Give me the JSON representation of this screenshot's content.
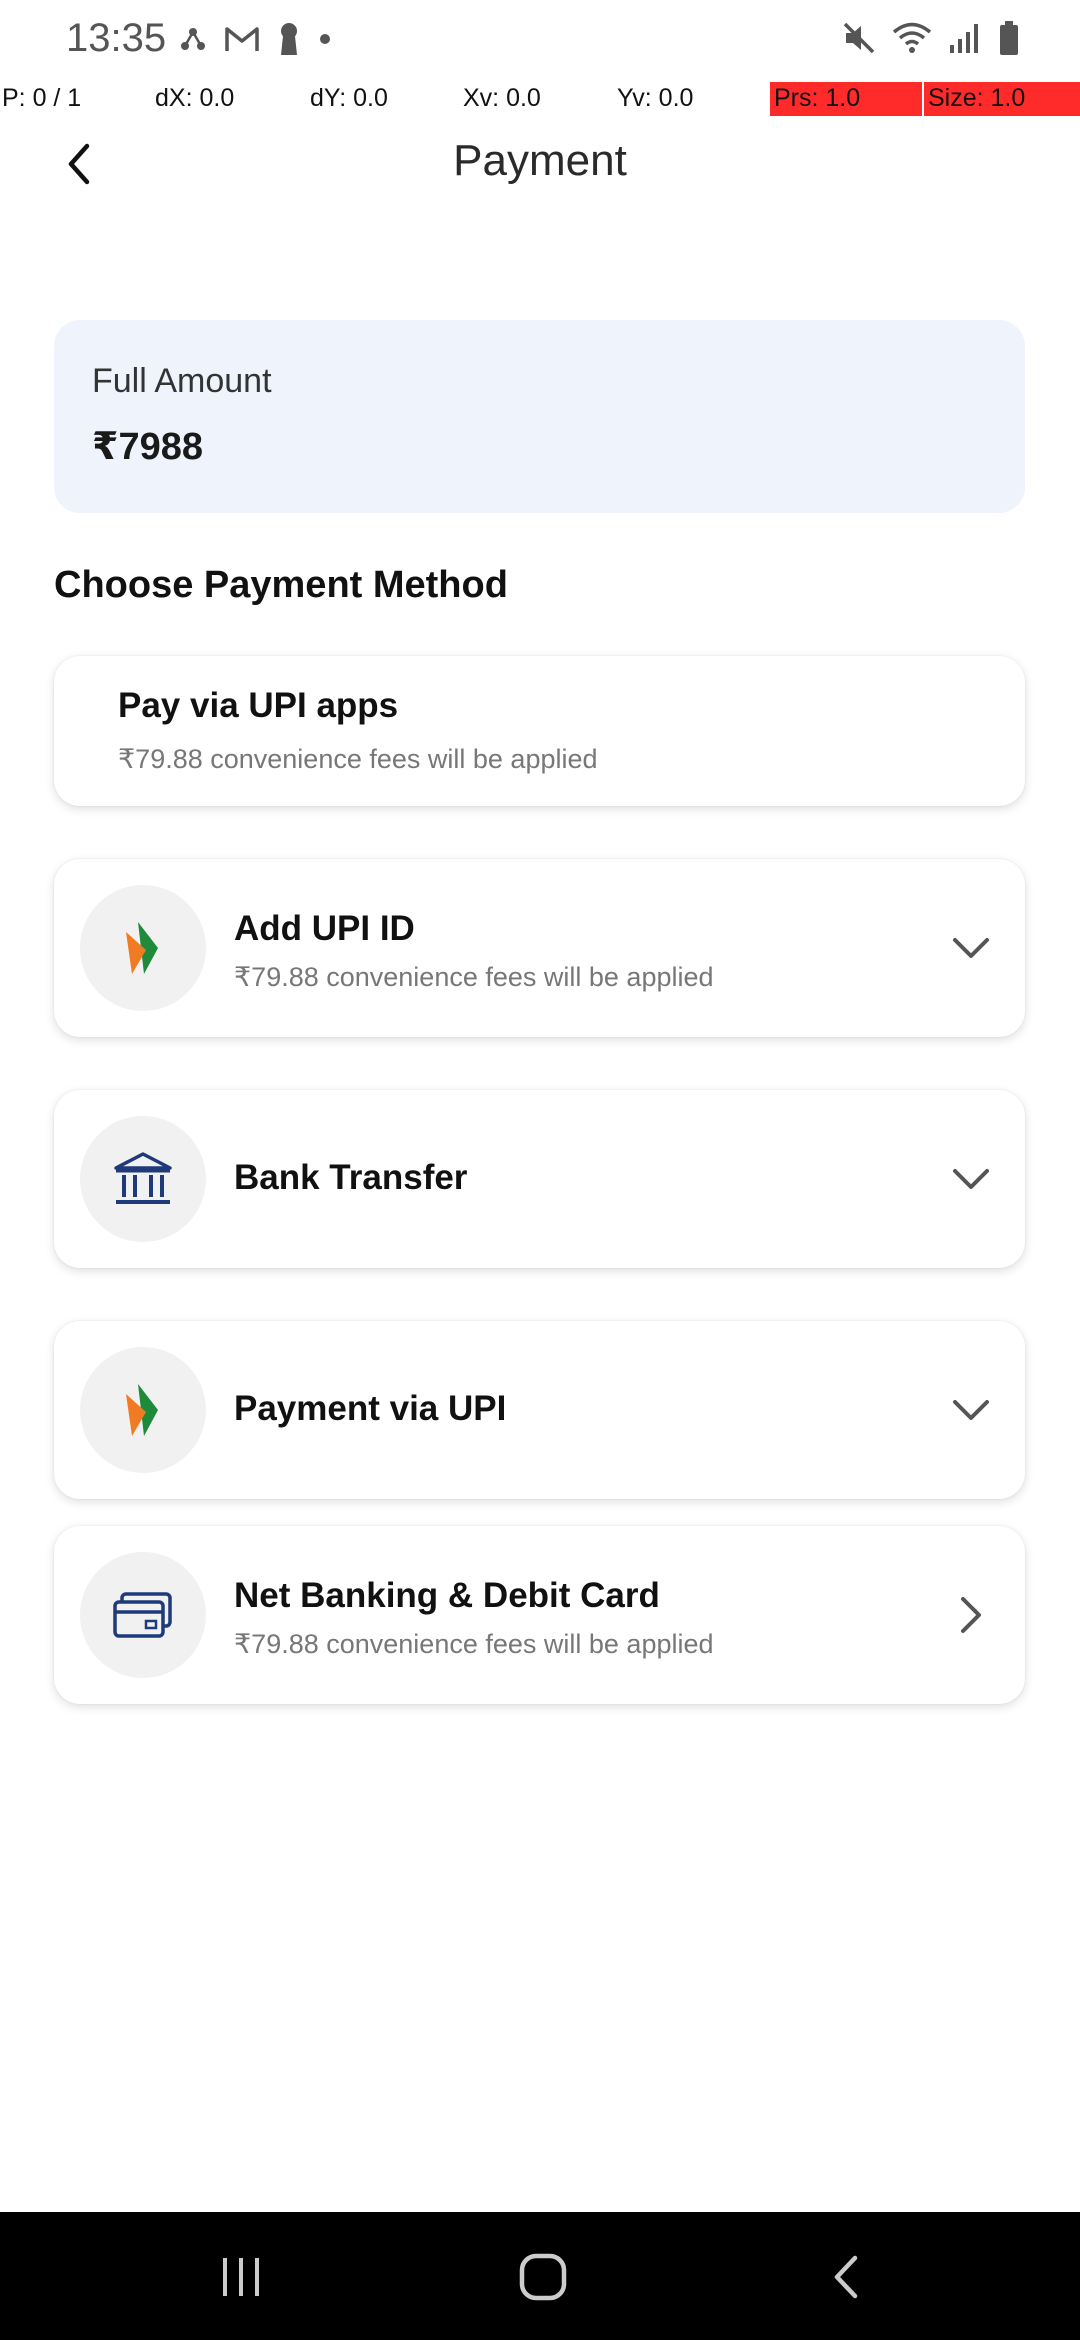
{
  "status_bar": {
    "time": "13:35",
    "left_icons": [
      "share-network-icon",
      "gmail-icon",
      "keyhole-icon",
      "dot-icon"
    ],
    "right_icons": [
      "mute-icon",
      "wifi-icon",
      "signal-icon",
      "battery-icon"
    ]
  },
  "pointer_overlay": {
    "p": "P: 0 / 1",
    "dx": "dX: 0.0",
    "dy": "dY: 0.0",
    "xv": "Xv: 0.0",
    "yv": "Yv: 0.0",
    "prs": "Prs: 1.0",
    "size": "Size: 1.0",
    "highlight_color": "#ff2b2b"
  },
  "header": {
    "title": "Payment"
  },
  "amount": {
    "label": "Full Amount",
    "value": "₹7988",
    "card_color": "#eef3fc"
  },
  "section": {
    "title": "Choose Payment Method"
  },
  "methods": [
    {
      "title": "Pay via UPI apps",
      "subtitle": "₹79.88 convenience fees will be applied"
    },
    {
      "icon": "bhim-upi-icon",
      "title": "Add UPI ID",
      "subtitle": "₹79.88 convenience fees will be applied",
      "chevron": "chevron-down-icon"
    },
    {
      "icon": "bank-icon",
      "title": "Bank Transfer",
      "chevron": "chevron-down-icon"
    },
    {
      "icon": "bhim-upi-icon",
      "title": "Payment via UPI",
      "chevron": "chevron-down-icon"
    },
    {
      "icon": "credit-card-icon",
      "title": "Net Banking & Debit Card",
      "subtitle": "₹79.88 convenience fees will be applied",
      "chevron": "chevron-right-icon"
    }
  ],
  "nav_bar": {
    "buttons": [
      "recent-apps-icon",
      "home-icon",
      "back-icon"
    ]
  }
}
